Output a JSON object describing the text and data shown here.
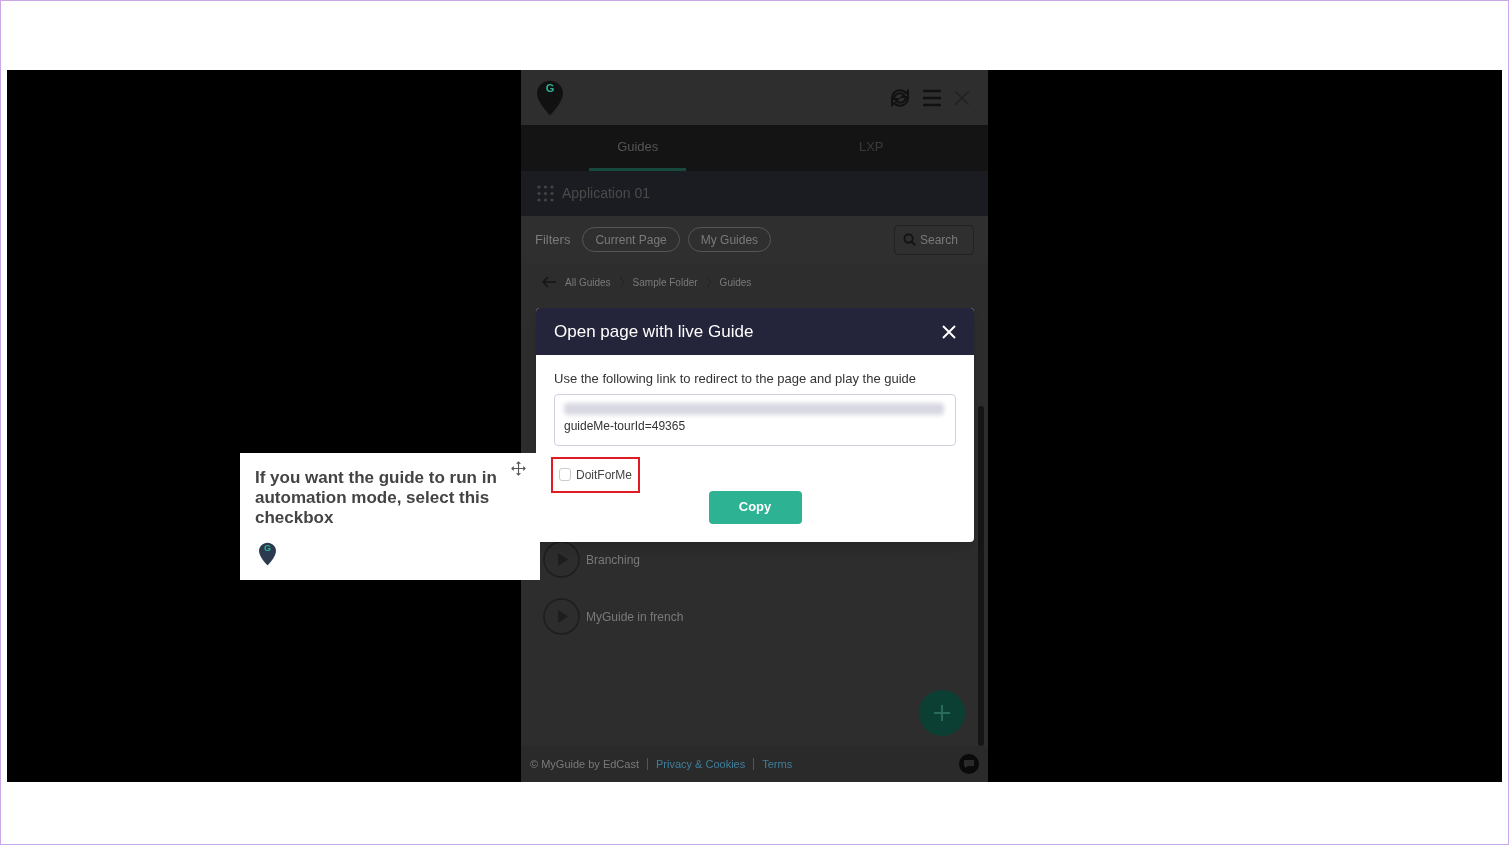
{
  "panel": {
    "logo_letter": "G",
    "tabs": [
      {
        "label": "Guides",
        "selected": true
      },
      {
        "label": "LXP",
        "selected": false
      }
    ],
    "application": "Application 01",
    "filters": {
      "label": "Filters",
      "chips": [
        {
          "label": "Current Page",
          "selected": false
        },
        {
          "label": "My Guides",
          "selected": false
        }
      ],
      "search_placeholder": "Search"
    },
    "breadcrumbs": [
      "All Guides",
      "Sample Folder",
      "Guides"
    ],
    "guides": [
      "Branching",
      "MyGuide in french"
    ],
    "footer": {
      "copyright": "© MyGuide by EdCast",
      "links": [
        "Privacy & Cookies",
        "Terms"
      ]
    }
  },
  "dialog": {
    "title": "Open page with live Guide",
    "instruction": "Use the following link to redirect to the page and play the guide",
    "link_visible": "guideMe-tourId=49365",
    "checkbox": {
      "label": "DoitForMe",
      "checked": false,
      "highlighted": true
    },
    "button": "Copy"
  },
  "tooltip": {
    "text": "If you want the guide to run in automation mode, select this checkbox",
    "logo_letter": "G"
  }
}
